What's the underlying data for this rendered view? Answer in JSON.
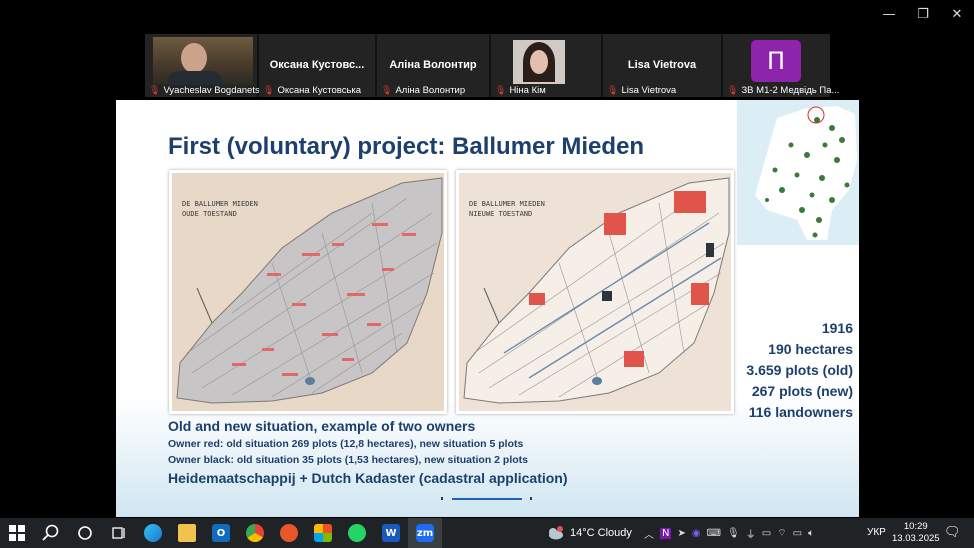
{
  "window": {
    "minimize": "—",
    "restore": "❐",
    "close": "✕"
  },
  "participants": [
    {
      "name": "Vyacheslav Bogdanets",
      "display": "",
      "muted": true
    },
    {
      "name": "Оксана Кустовська",
      "display": "Оксана  Кустовс...",
      "muted": true
    },
    {
      "name": "Аліна Волонтир",
      "display": "Аліна Волонтир",
      "muted": true
    },
    {
      "name": "Ніна Кім",
      "display": "",
      "muted": true
    },
    {
      "name": "Lisa Vietrova",
      "display": "Lisa Vietrova",
      "muted": true
    },
    {
      "name": "ЗВ М1-2 Медвідь Па...",
      "display": "",
      "avatar_letter": "П",
      "muted": true
    }
  ],
  "slide": {
    "title": "First (voluntary) project: Ballumer Mieden",
    "map_left_label": [
      "DE BALLUMER MIEDEN",
      "OUDE TOESTAND"
    ],
    "map_right_label": [
      "DE BALLUMER MIEDEN",
      "NIEUWE TOESTAND"
    ],
    "stats": [
      "1916",
      "190 hectares",
      "3.659 plots (old)",
      "267 plots (new)",
      "116 landowners"
    ],
    "caption_main": "Old and new situation, example of two owners",
    "caption_red": "Owner red: old situation 269 plots (12,8 hectares), new situation 5 plots",
    "caption_black": "Owner black: old situation 35 plots (1,53 hectares), new situation 2 plots",
    "caption_footer": "Heidemaatschappij + Dutch Kadaster (cadastral application)"
  },
  "taskbar": {
    "apps": [
      "start-icon",
      "search-icon",
      "cortana-icon",
      "task-view-icon",
      "edge-icon",
      "file-explorer-icon",
      "outlook-icon",
      "chrome-icon",
      "app-icon",
      "store-icon",
      "whatsapp-icon",
      "word-icon",
      "zoom-icon"
    ],
    "zoom_label": "zm",
    "word_label": "W",
    "weather": "14°C  Cloudy",
    "language": "УКР",
    "time": "10:29",
    "date": "13.03.2025"
  },
  "colors": {
    "slide_title": "#1c3f6e",
    "owner_red": "#e0544b",
    "owner_black": "#2d3440",
    "zoom_accent": "#1e6cf2"
  }
}
